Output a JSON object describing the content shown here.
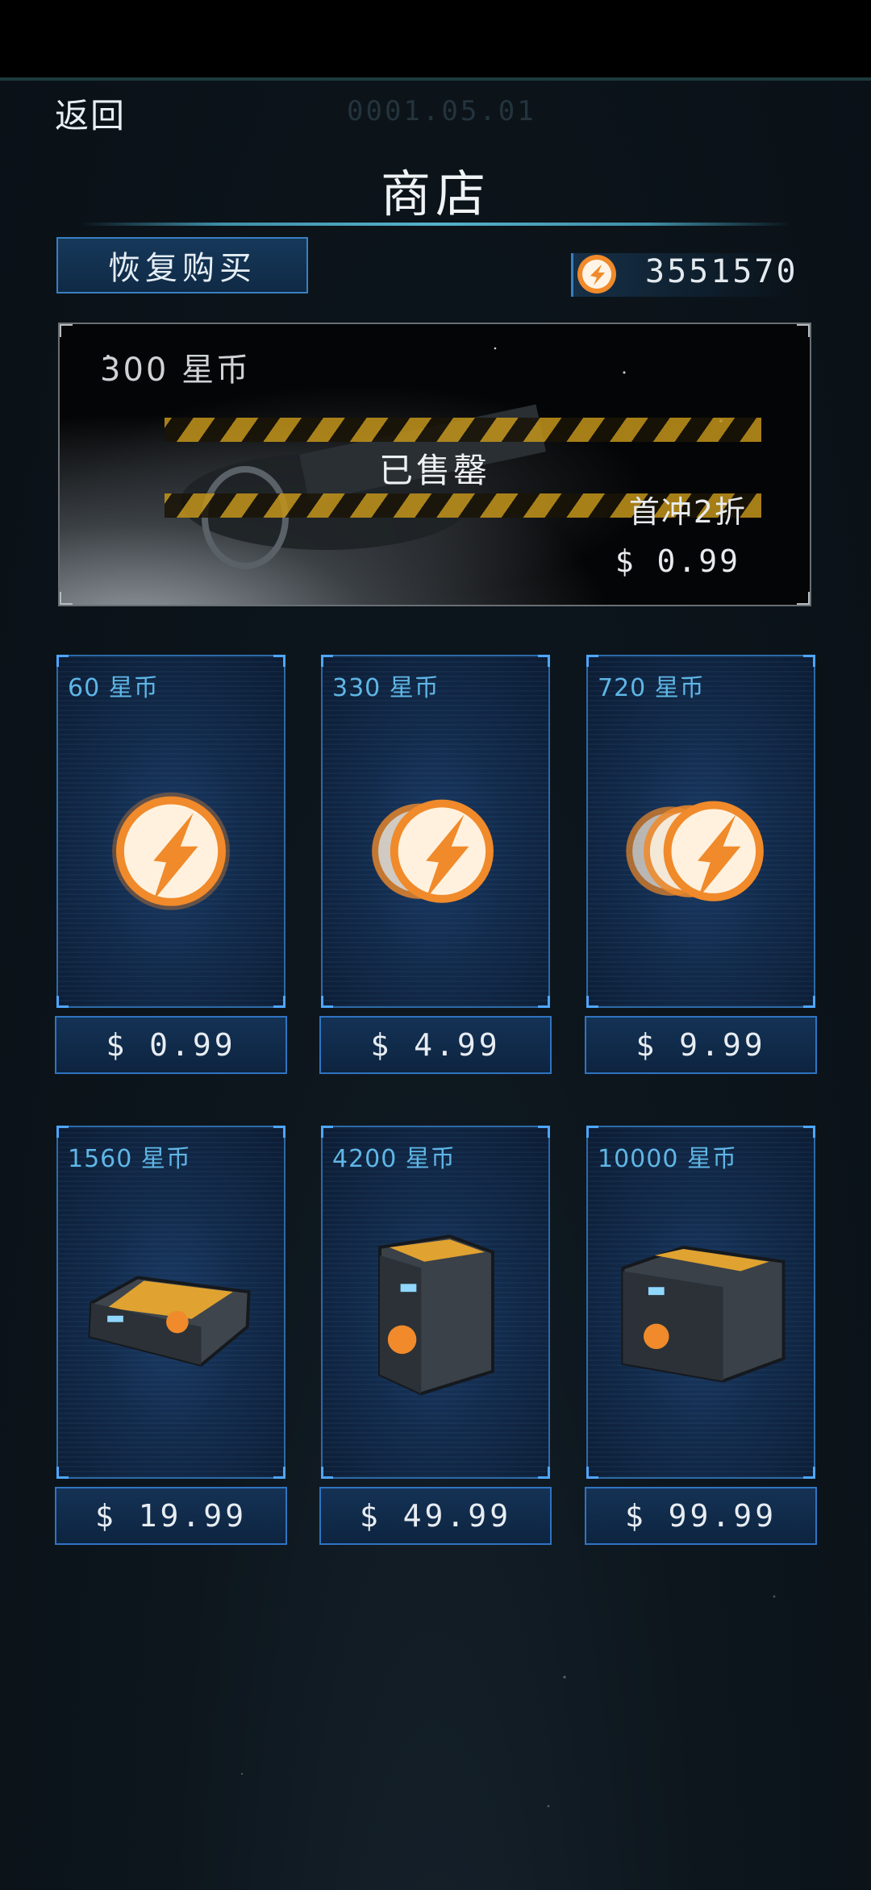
{
  "header": {
    "back_label": "返回",
    "date_text": "0001.05.01",
    "title": "商店"
  },
  "toolbar": {
    "restore_label": "恢复购买",
    "coin_balance": "3551570",
    "coin_icon": "star-coin-icon"
  },
  "banner": {
    "amount_label": "300 星币",
    "status_label": "已售罄",
    "discount_label": "首冲2折",
    "price_label": "$ 0.99"
  },
  "products": [
    {
      "amount_label": "60 星币",
      "price_label": "$ 0.99",
      "icon": "coin-single-icon"
    },
    {
      "amount_label": "330 星币",
      "price_label": "$ 4.99",
      "icon": "coin-double-icon"
    },
    {
      "amount_label": "720 星币",
      "price_label": "$ 9.99",
      "icon": "coin-triple-icon"
    },
    {
      "amount_label": "1560 星币",
      "price_label": "$ 19.99",
      "icon": "coin-case-icon"
    },
    {
      "amount_label": "4200 星币",
      "price_label": "$ 49.99",
      "icon": "coin-crate-icon"
    },
    {
      "amount_label": "10000 星币",
      "price_label": "$ 99.99",
      "icon": "coin-container-icon"
    }
  ],
  "colors": {
    "accent_blue": "#2c6aa8",
    "label_cyan": "#5fb6e6",
    "coin_orange": "#f08a2a"
  }
}
